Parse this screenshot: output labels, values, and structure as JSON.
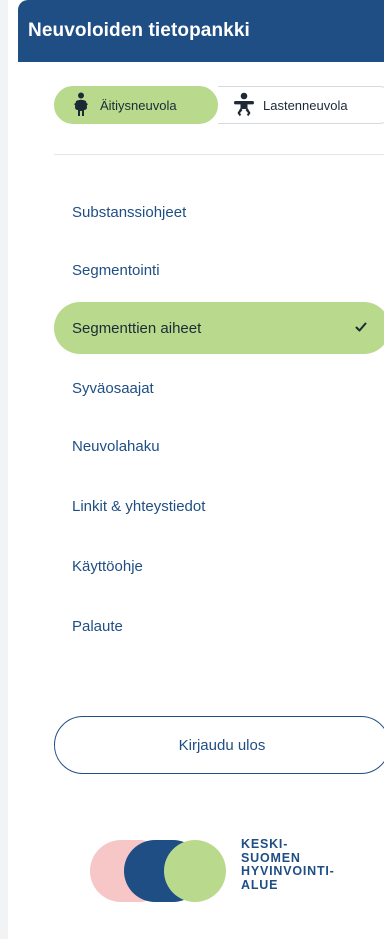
{
  "header": {
    "title": "Neuvoloiden tietopankki"
  },
  "clinic_toggle": {
    "options": [
      {
        "label": "Äitiysneuvola",
        "icon": "pregnant-person-icon",
        "selected": true
      },
      {
        "label": "Lastenneuvola",
        "icon": "baby-icon",
        "selected": false
      }
    ]
  },
  "nav": {
    "items": [
      {
        "label": "Substanssiohjeet",
        "active": false
      },
      {
        "label": "Segmentointi",
        "active": false
      },
      {
        "label": "Segmenttien aiheet",
        "active": true
      },
      {
        "label": "Syväosaajat",
        "active": false
      },
      {
        "label": "Neuvolahaku",
        "active": false
      },
      {
        "label": "Linkit & yhteystiedot",
        "active": false
      },
      {
        "label": "Käyttöohje",
        "active": false
      },
      {
        "label": "Palaute",
        "active": false
      }
    ]
  },
  "logout": {
    "label": "Kirjaudu ulos"
  },
  "logo": {
    "lines": [
      "KESKI-",
      "SUOMEN",
      "HYVINVOINTI-",
      "ALUE"
    ],
    "colors": {
      "pink": "#f7c6c7",
      "navy": "#1f4e84",
      "green": "#b9d98d"
    }
  },
  "colors": {
    "brand_navy": "#1f4e84",
    "accent_green": "#b9d98d",
    "text_dark": "#1d2a36"
  }
}
